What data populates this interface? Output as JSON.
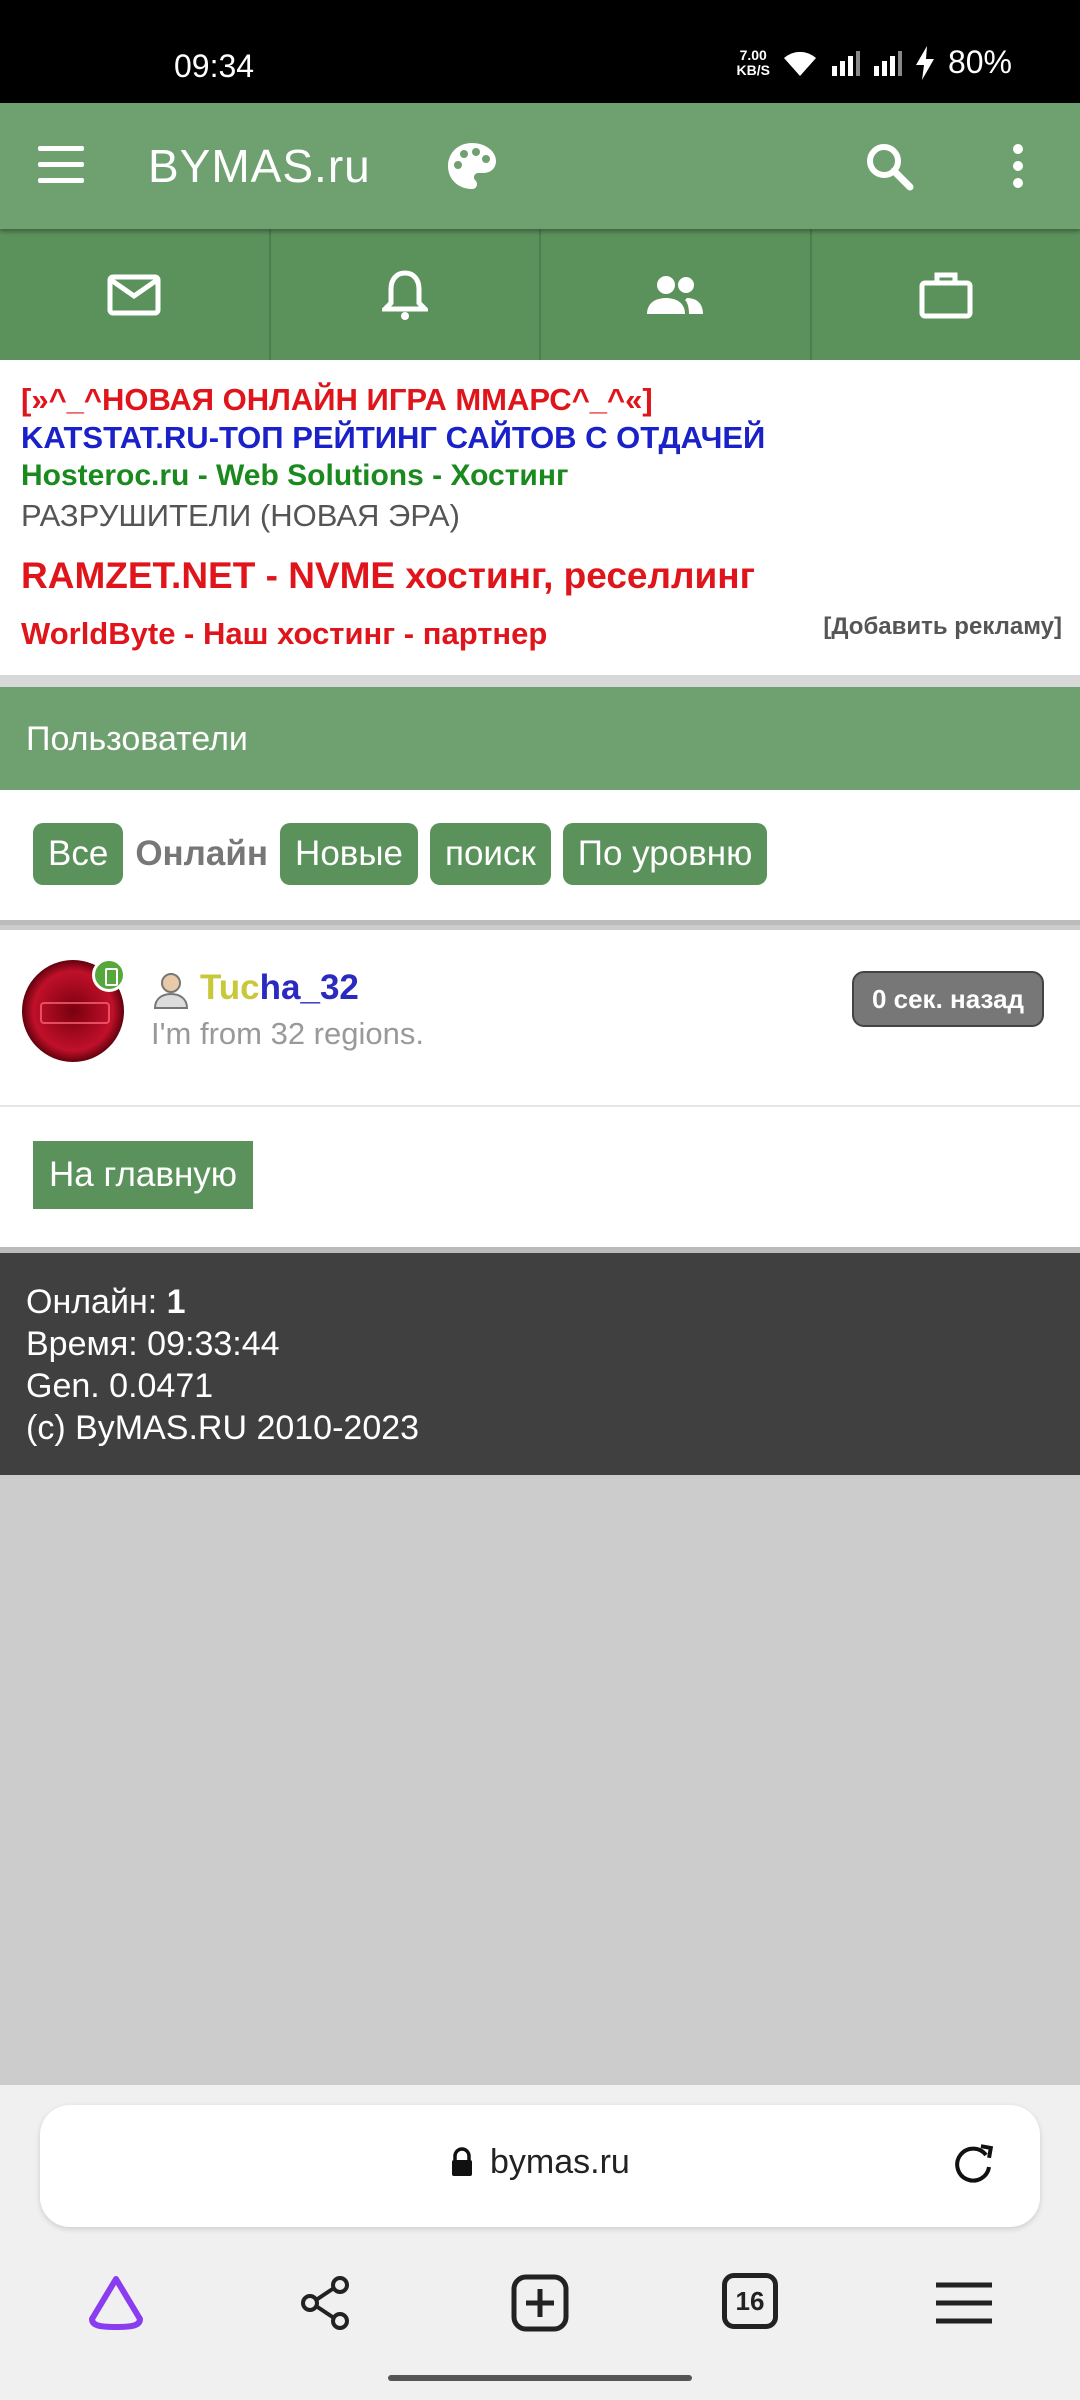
{
  "status_bar": {
    "time": "09:34",
    "net_speed_value": "7.00",
    "net_speed_unit": "KB/S",
    "battery": "80%"
  },
  "app_bar": {
    "title": "BYMAS.ru",
    "icons": [
      "menu-icon",
      "palette-icon",
      "search-icon",
      "more-vert-icon"
    ]
  },
  "tabs": [
    {
      "icon": "mail-icon"
    },
    {
      "icon": "bell-icon"
    },
    {
      "icon": "people-icon"
    },
    {
      "icon": "briefcase-icon"
    }
  ],
  "ads": {
    "items": [
      "[»^_^НОВАЯ ОНЛАЙН ИГРА ММАРС^_^«]",
      "KATSTAT.RU-ТОП РЕЙТИНГ САЙТОВ С ОТДАЧЕЙ",
      "Hosteroc.ru - Web Solutions - Хостинг",
      "РАЗРУШИТЕЛИ (НОВАЯ ЭРА)",
      "RAMZET.NET - NVME хостинг, реселлинг",
      "WorldByte - Наш хостинг - партнер"
    ],
    "add_link": "[Добавить рекламу]",
    "colors": {
      "red": "#e0151b",
      "blue": "#1a21c8",
      "green": "#1a8a1e",
      "gray": "#555555"
    }
  },
  "section": {
    "title": "Пользователи",
    "filters": {
      "all": "Все",
      "online": "Онлайн",
      "new": "Новые",
      "search": "поиск",
      "by_level": "По уровню"
    }
  },
  "user": {
    "name_part1": "Tuc",
    "name_part2": "ha_32",
    "status": "I'm from 32 regions.",
    "time_ago": "0 сек. назад"
  },
  "home_button": "На главную",
  "footer": {
    "online_label": "Онлайн: ",
    "online_count": "1",
    "time_line": "Время: 09:33:44",
    "gen_line": "Gen. 0.0471",
    "copyright": "(c) ByMAS.RU 2010-2023"
  },
  "browser": {
    "url": "bymas.ru",
    "tab_count": "16"
  },
  "theme": {
    "accent_green": "#6fa070",
    "dark_green": "#5b925c",
    "footer_bg": "#404040"
  }
}
